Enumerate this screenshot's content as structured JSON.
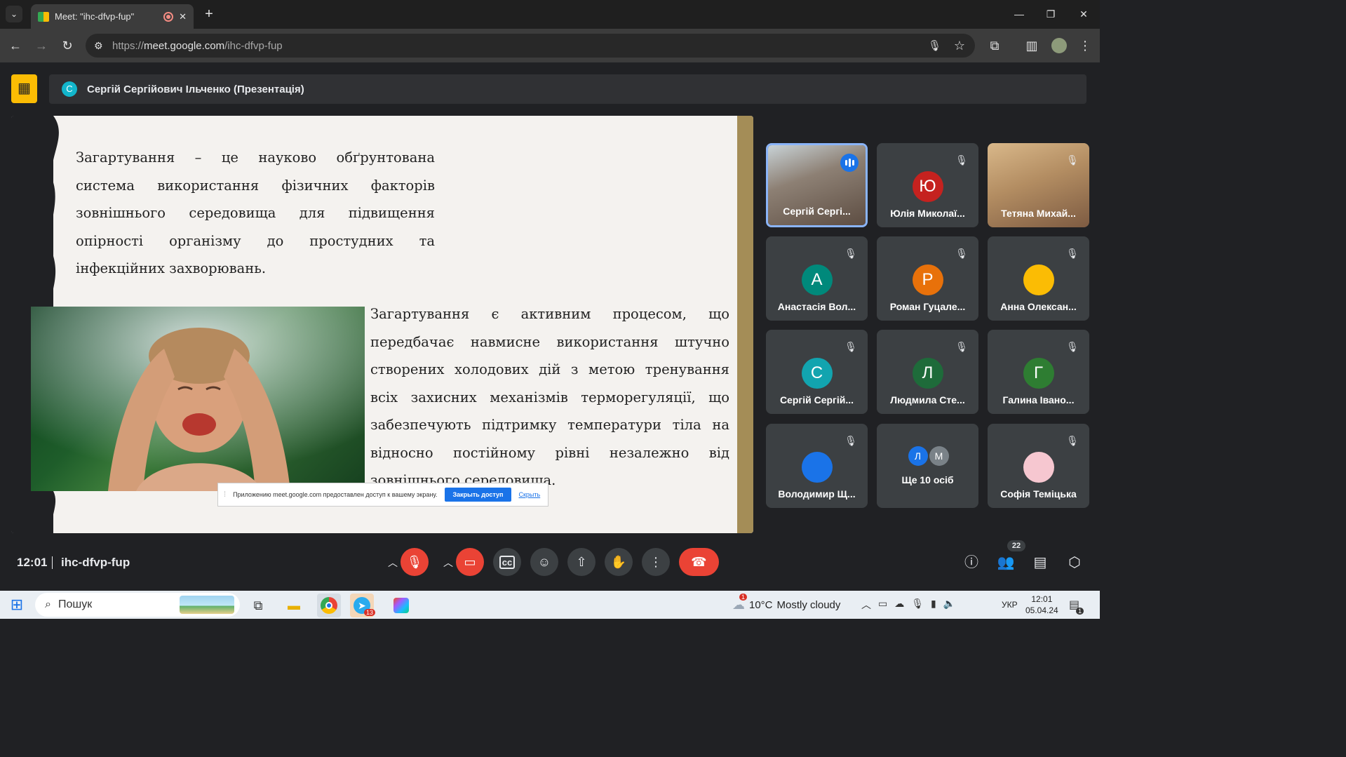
{
  "browser": {
    "tab_title": "Meet: \"ihc-dfvp-fup\"",
    "tab_close": "✕",
    "new_tab": "+",
    "url_prefix": "https://",
    "url_host": "meet.google.com",
    "url_path": "/ihc-dfvp-fup"
  },
  "meet": {
    "presenter_initial": "С",
    "presenter_label": "Сергій Сергійович Ільченко (Презентація)"
  },
  "slide": {
    "paragraph1": "Загартування – це науково обґрунтована система використання фізичних факторів зовнішнього середовища для підвищення опірності організму до простудних та інфекційних захворювань.",
    "paragraph2": "Загартування є активним процесом, що передбачає навмисне використання штучно створених холодових дій з метою тренування всіх захисних механізмів терморегуляції, що забезпечують підтримку температури тіла на відносно постійному рівні незалежно від зовнішнього середовища."
  },
  "share_toast": {
    "message": "Приложению meet.google.com предоставлен доступ к вашему экрану.",
    "stop_label": "Закрыть доступ",
    "hide_label": "Скрыть"
  },
  "participants": [
    {
      "name": "Сергій Сергі...",
      "initial": "",
      "color": "",
      "video": true,
      "speaking": true
    },
    {
      "name": "Юлія Миколаї...",
      "initial": "Ю",
      "color": "#c5221f",
      "video": false,
      "speaking": false
    },
    {
      "name": "Тетяна Михай...",
      "initial": "",
      "color": "",
      "video": true,
      "speaking": false
    },
    {
      "name": "Анастасія Вол...",
      "initial": "А",
      "color": "#00897b",
      "video": false,
      "speaking": false
    },
    {
      "name": "Роман Гуцале...",
      "initial": "Р",
      "color": "#e8710a",
      "video": false,
      "speaking": false
    },
    {
      "name": "Анна Олексан...",
      "initial": "",
      "color": "#fbbc04",
      "video": false,
      "speaking": false
    },
    {
      "name": "Сергій Сергій...",
      "initial": "С",
      "color": "#12a4af",
      "video": false,
      "speaking": false
    },
    {
      "name": "Людмила Сте...",
      "initial": "Л",
      "color": "#1e6b3a",
      "video": false,
      "speaking": false
    },
    {
      "name": "Галина Івано...",
      "initial": "Г",
      "color": "#2e7d32",
      "video": false,
      "speaking": false
    },
    {
      "name": "Володимир Щ...",
      "initial": "",
      "color": "#1a73e8",
      "video": false,
      "speaking": false
    },
    {
      "name": "Ще 10 осіб",
      "initial": "",
      "color": "",
      "video": false,
      "speaking": false
    },
    {
      "name": "Софія Теміцька",
      "initial": "",
      "color": "#f6c7d0",
      "video": false,
      "speaking": false
    }
  ],
  "more_people": {
    "initials": [
      "Л",
      "М"
    ]
  },
  "bottom_bar": {
    "time": "12:01",
    "meeting_code": "ihc-dfvp-fup",
    "participant_count": "22"
  },
  "taskbar": {
    "search_placeholder": "Пошук",
    "telegram_badge": "13",
    "weather_badge": "1",
    "temperature": "10°C",
    "weather_text": "Mostly cloudy",
    "language": "УКР",
    "time": "12:01",
    "date": "05.04.24",
    "notification_badge": "1"
  }
}
